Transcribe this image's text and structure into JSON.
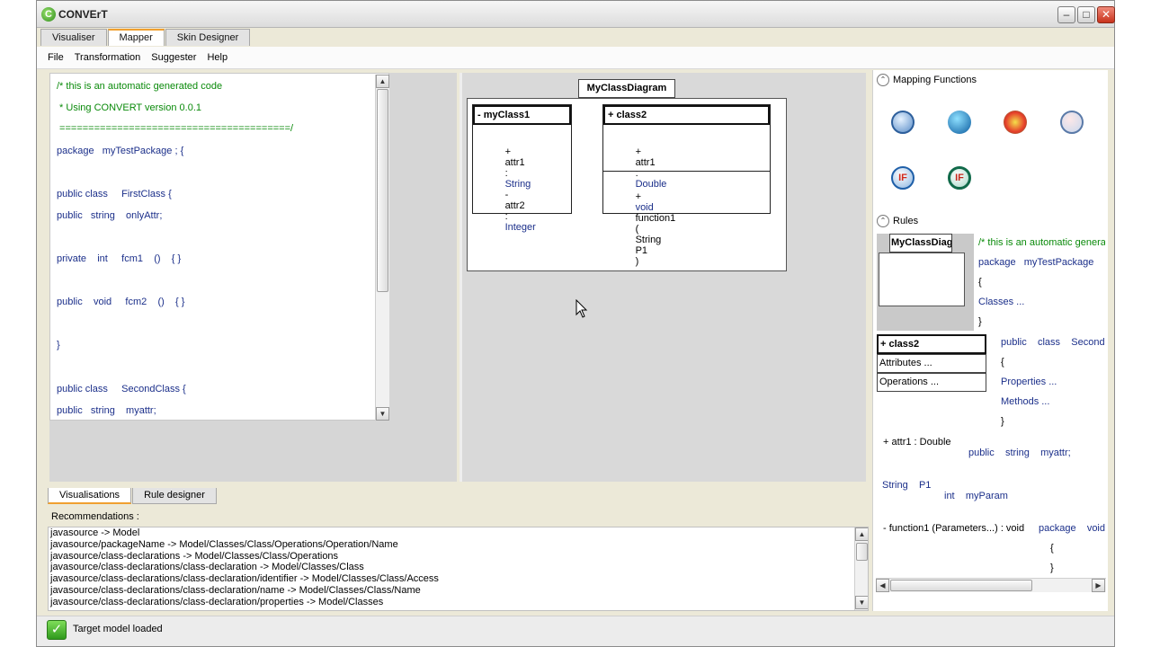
{
  "window": {
    "title": "CONVErT",
    "minimize": "–",
    "maximize": "□",
    "close": "✕"
  },
  "tabs": [
    {
      "label": "Visualiser",
      "active": false
    },
    {
      "label": "Mapper",
      "active": true
    },
    {
      "label": "Skin Designer",
      "active": false
    }
  ],
  "menu": [
    "File",
    "Transformation",
    "Suggester",
    "Help"
  ],
  "code": {
    "lines": [
      {
        "text": "/* this is an automatic generated code",
        "style": "comment"
      },
      {
        "text": " * Using CONVERT version 0.0.1",
        "style": "comment"
      },
      {
        "text": " ========================================/",
        "style": "comment"
      },
      {
        "text": "package   myTestPackage ; {",
        "style": "kw"
      },
      {
        "text": "public class     FirstClass {",
        "style": "kw"
      },
      {
        "text": "public   string    onlyAttr;",
        "style": "kw"
      },
      {
        "text": "private    int     fcm1    ()    { }",
        "style": "kw"
      },
      {
        "text": "public    void     fcm2    ()    { }",
        "style": "kw"
      },
      {
        "text": "}",
        "style": "kw"
      },
      {
        "text": "public class     SecondClass {",
        "style": "kw"
      },
      {
        "text": "public   string    myattr;",
        "style": "kw"
      }
    ]
  },
  "diagram": {
    "title": "MyClassDiagram",
    "class1": {
      "name": "- myClass1",
      "attrs": [
        {
          "vis": "+",
          "name": "attr1",
          "sep": ":",
          "type": "String"
        },
        {
          "vis": "-",
          "name": "attr2",
          "sep": ":",
          "type": "Integer"
        }
      ]
    },
    "class2": {
      "name": "+ class2",
      "attr": {
        "vis": "+",
        "name": "attr1",
        "sep": ":",
        "type": "Double"
      },
      "op": {
        "vis": "+",
        "ret": "void",
        "name": "function1",
        "open": "(",
        "ptype": "String",
        "pname": "P1",
        "close": ")"
      }
    }
  },
  "right": {
    "mapping_title": "Mapping Functions",
    "rules_title": "Rules",
    "collapse_symbol": "⌃",
    "icons": [
      "swap-function-icon",
      "globe-function-icon",
      "star-function-icon",
      "reverse-function-icon",
      "if-function-icon",
      "conditional-if-function-icon"
    ],
    "if_label": "IF",
    "rules": {
      "mini_title": "MyClassDiag",
      "code1": "/* this is an automatic genera",
      "code2": "package   myTestPackage",
      "brace_open": "{",
      "classes": "Classes ...",
      "brace_close": "}",
      "class_head": "+ class2",
      "attributes": "Attributes ...",
      "operations": "Operations ...",
      "public_class": "public    class    SecondC",
      "properties": "Properties ...",
      "methods": "Methods ...",
      "attr_rule": "+ attr1 : Double",
      "public_string": "public    string    myattr;",
      "param_type": "String    P1",
      "int_param": "int    myParam",
      "function_rule": "- function1 (Parameters...) : void",
      "package_void": "package    void"
    }
  },
  "bottom": {
    "tabs": [
      {
        "label": "Visualisations",
        "active": true
      },
      {
        "label": "Rule designer",
        "active": false
      }
    ],
    "recommendations_label": "Recommendations :",
    "recommendations": [
      "javasource -> Model",
      "javasource/packageName -> Model/Classes/Class/Operations/Operation/Name",
      "javasource/class-declarations -> Model/Classes/Class/Operations",
      "javasource/class-declarations/class-declaration -> Model/Classes/Class",
      "javasource/class-declarations/class-declaration/identifier -> Model/Classes/Class/Access",
      "javasource/class-declarations/class-declaration/name -> Model/Classes/Class/Name",
      "javasource/class-declarations/class-declaration/properties -> Model/Classes"
    ]
  },
  "status": {
    "text": "Target model loaded",
    "check": "✓"
  },
  "scroll": {
    "up": "▲",
    "down": "▼",
    "left": "◀",
    "right": "▶"
  },
  "colors": {
    "comment": "#0a8a0a",
    "keyword": "#1b2f8a",
    "active_tab": "#f0a030"
  }
}
